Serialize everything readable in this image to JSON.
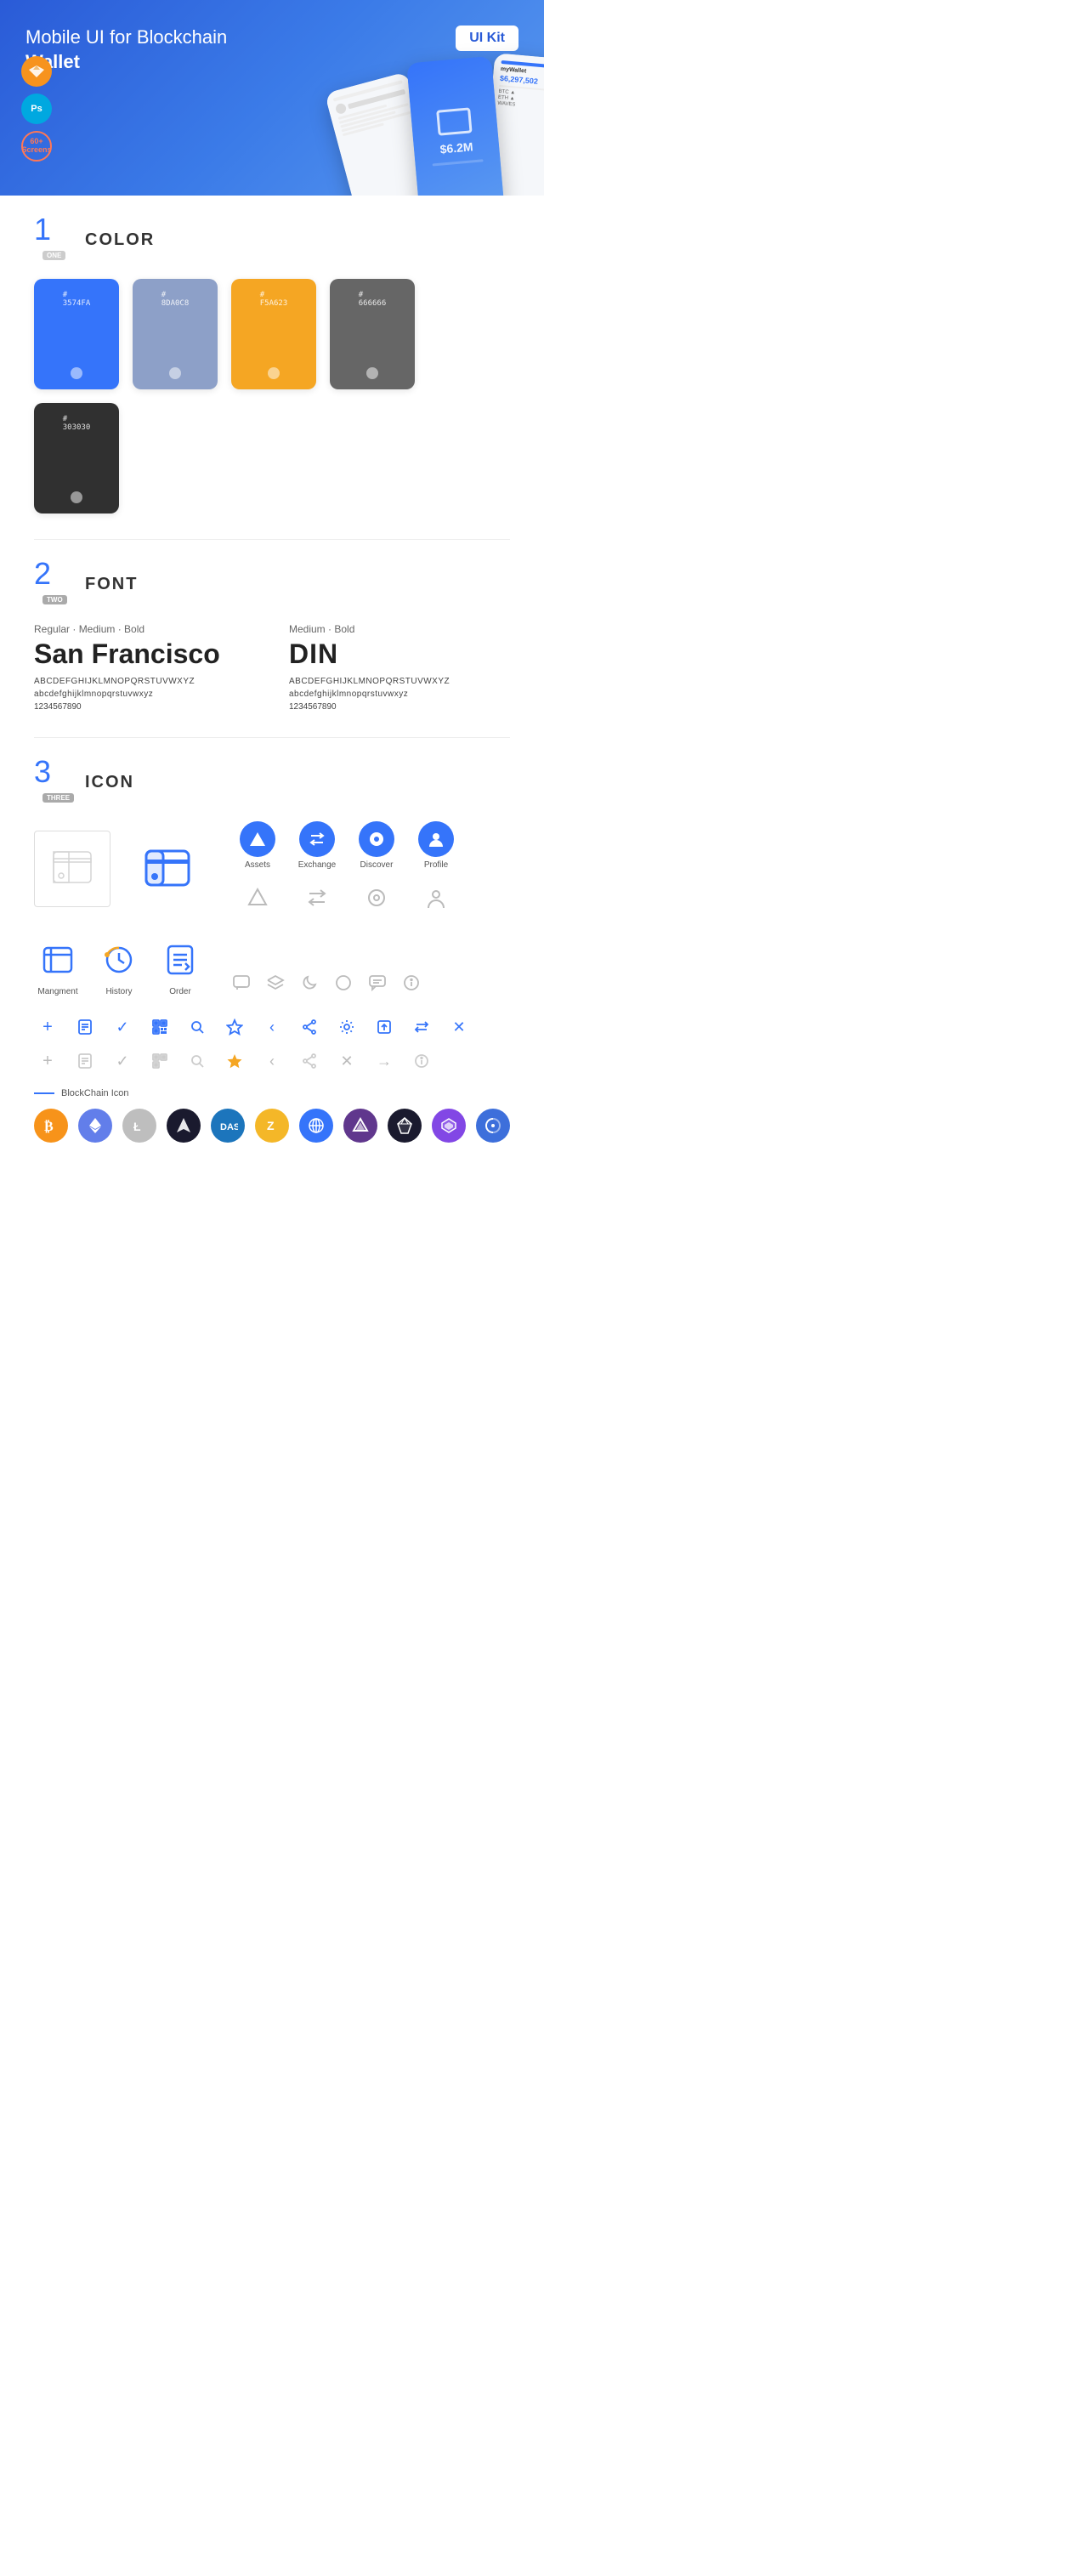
{
  "hero": {
    "title_part1": "Mobile UI for Blockchain ",
    "title_bold": "Wallet",
    "badge": "UI Kit",
    "sketch_label": "S",
    "ps_label": "Ps",
    "screens_label": "60+\nScreens"
  },
  "sections": {
    "color": {
      "number": "1",
      "number_label": "ONE",
      "title": "COLOR",
      "swatches": [
        {
          "hex": "#3574FA",
          "code": "#\n3574FA"
        },
        {
          "hex": "#8DA0C8",
          "code": "#\n8DA0C8"
        },
        {
          "hex": "#F5A623",
          "code": "#\nF5A623"
        },
        {
          "hex": "#666666",
          "code": "#\n666666"
        },
        {
          "hex": "#303030",
          "code": "#\n303030"
        }
      ]
    },
    "font": {
      "number": "2",
      "number_label": "TWO",
      "title": "FONT",
      "fonts": [
        {
          "style": "Regular · Medium · Bold",
          "name": "San Francisco",
          "alphabet_upper": "ABCDEFGHIJKLMNOPQRSTUVWXYZ",
          "alphabet_lower": "abcdefghijklmnopqrstuvwxyz",
          "numbers": "1234567890"
        },
        {
          "style": "Medium · Bold",
          "name": "DIN",
          "alphabet_upper": "ABCDEFGHIJKLMNOPQRSTUVWXYZ",
          "alphabet_lower": "abcdefghijklmnopqrstuvwxyz",
          "numbers": "1234567890"
        }
      ]
    },
    "icon": {
      "number": "3",
      "number_label": "THREE",
      "title": "ICON",
      "nav_items": [
        {
          "label": "Assets"
        },
        {
          "label": "Exchange"
        },
        {
          "label": "Discover"
        },
        {
          "label": "Profile"
        }
      ],
      "bottom_icons": [
        {
          "label": "Mangment"
        },
        {
          "label": "History"
        },
        {
          "label": "Order"
        }
      ],
      "blockchain_label": "BlockChain Icon"
    }
  }
}
